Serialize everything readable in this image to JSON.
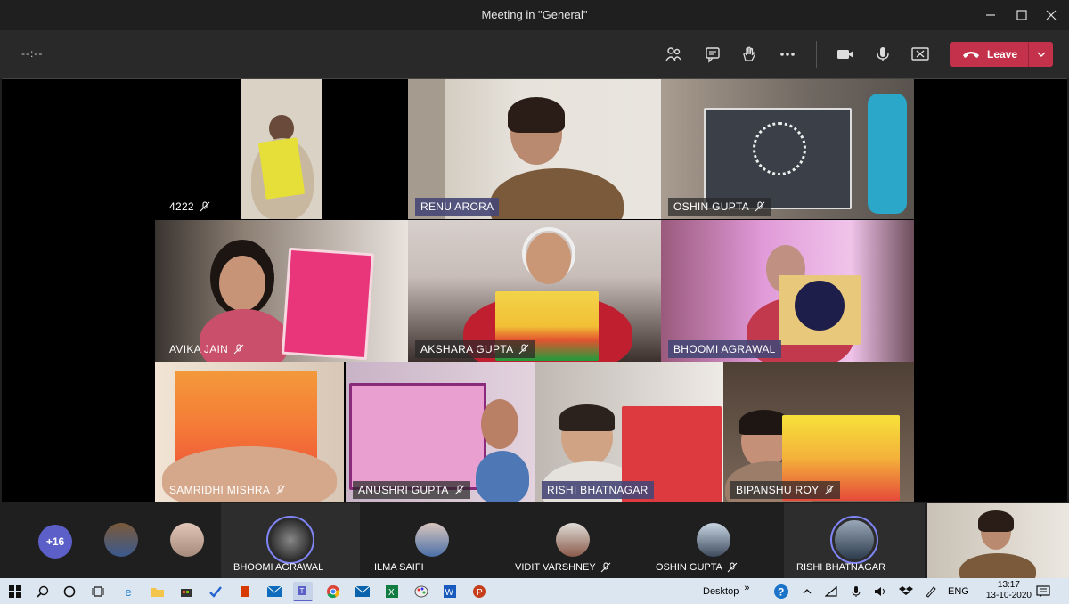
{
  "window": {
    "title": "Meeting in \"General\""
  },
  "toolbar": {
    "timer": "--:--",
    "leave_label": "Leave"
  },
  "tiles": [
    {
      "name": "4222"
    },
    {
      "name": "RENU ARORA"
    },
    {
      "name": "OSHIN GUPTA"
    },
    {
      "name": "AVIKA JAIN"
    },
    {
      "name": "AKSHARA GUPTA"
    },
    {
      "name": "BHOOMI AGRAWAL"
    },
    {
      "name": "SAMRIDHI MISHRA"
    },
    {
      "name": "ANUSHRI GUPTA"
    },
    {
      "name": "RISHI BHATNAGAR"
    },
    {
      "name": "BIPANSHU ROY"
    }
  ],
  "strip": {
    "overflow_count": "+16",
    "participants": [
      {
        "name": "BHOOMI AGRAWAL"
      },
      {
        "name": "ILMA SAIFI"
      },
      {
        "name": "VIDIT VARSHNEY"
      },
      {
        "name": "OSHIN GUPTA"
      },
      {
        "name": "RISHI BHATNAGAR"
      }
    ]
  },
  "taskbar": {
    "desktop_label": "Desktop",
    "lang": "ENG",
    "time": "13:17",
    "date": "13-10-2020",
    "chevron": "»"
  },
  "colors": {
    "accent": "#5b5fc7",
    "leave": "#c4314b",
    "label_bg": "#464775"
  }
}
